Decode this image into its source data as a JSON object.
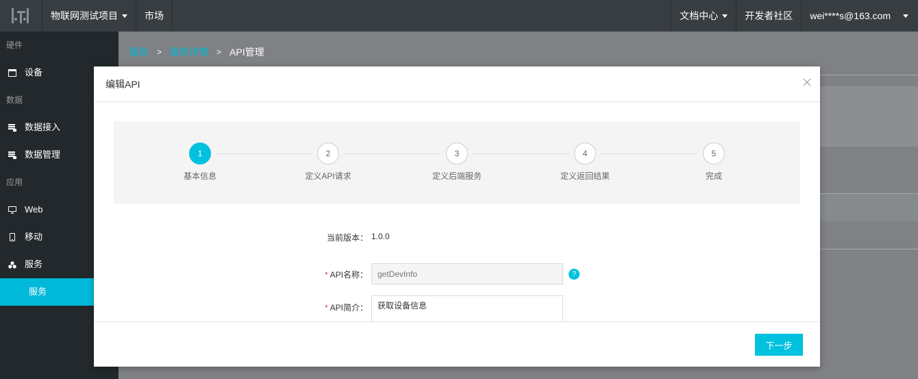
{
  "topbar": {
    "project": "物联网测试项目",
    "market": "市场",
    "docs": "文档中心",
    "community": "开发者社区",
    "user": "wei****s@163.com"
  },
  "sidebar": {
    "groups": [
      {
        "label": "硬件",
        "items": [
          {
            "label": "设备",
            "icon": "device-icon"
          }
        ]
      },
      {
        "label": "数据",
        "items": [
          {
            "label": "数据接入",
            "icon": "data-icon"
          },
          {
            "label": "数据管理",
            "icon": "data-icon"
          }
        ]
      },
      {
        "label": "应用",
        "items": [
          {
            "label": "Web",
            "icon": "monitor-icon"
          },
          {
            "label": "移动",
            "icon": "mobile-icon"
          },
          {
            "label": "服务",
            "icon": "service-icon"
          }
        ]
      }
    ],
    "active_sub": "服务"
  },
  "breadcrumb": [
    "服务",
    "服务详情",
    "API管理"
  ],
  "modal": {
    "title": "编辑API",
    "steps": [
      {
        "num": "1",
        "label": "基本信息",
        "active": true
      },
      {
        "num": "2",
        "label": "定义API请求",
        "active": false
      },
      {
        "num": "3",
        "label": "定义后端服务",
        "active": false
      },
      {
        "num": "4",
        "label": "定义返回结果",
        "active": false
      },
      {
        "num": "5",
        "label": "完成",
        "active": false
      }
    ],
    "form": {
      "version_label": "当前版本：",
      "version_value": "1.0.0",
      "name_label": "API名称：",
      "name_placeholder": "getDevInfo",
      "desc_label": "API简介：",
      "desc_value": "获取设备信息"
    },
    "next_button": "下一步"
  },
  "colors": {
    "accent": "#00c1de",
    "topbar": "#373d41",
    "sidebar": "#22282b"
  }
}
